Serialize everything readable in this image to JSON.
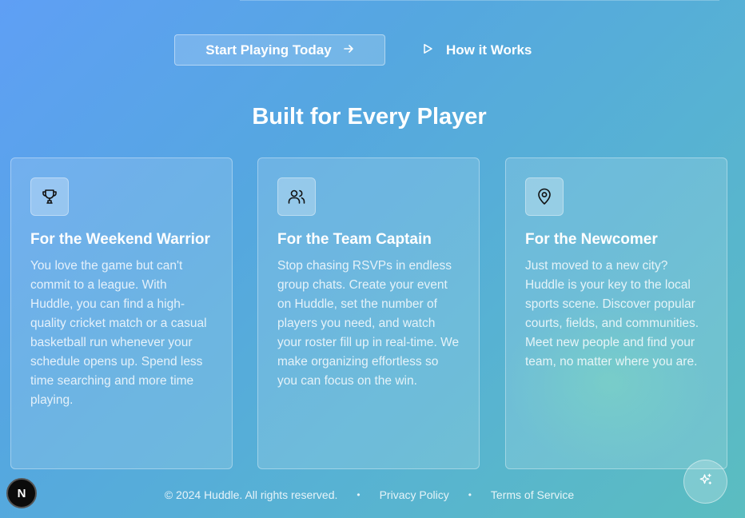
{
  "hero": {
    "primary_cta": "Start Playing Today",
    "primary_cta_icon": "arrow-right-icon",
    "secondary_cta": "How it Works",
    "secondary_cta_icon": "play-icon"
  },
  "section": {
    "title": "Built for Every Player",
    "cards": [
      {
        "icon": "trophy-icon",
        "title": "For the Weekend Warrior",
        "body": "You love the game but can't commit to a league. With Huddle, you can find a high-quality cricket match or a casual basketball run whenever your schedule opens up. Spend less time searching and more time playing."
      },
      {
        "icon": "users-icon",
        "title": "For the Team Captain",
        "body": "Stop chasing RSVPs in endless group chats. Create your event on Huddle, set the number of players you need, and watch your roster fill up in real-time. We make organizing effortless so you can focus on the win."
      },
      {
        "icon": "map-pin-icon",
        "title": "For the Newcomer",
        "body": "Just moved to a new city? Huddle is your key to the local sports scene. Discover popular courts, fields, and communities. Meet new people and find your team, no matter where you are."
      }
    ]
  },
  "footer": {
    "copyright": "© 2024 Huddle. All rights reserved.",
    "separator": "•",
    "privacy": "Privacy Policy",
    "terms": "Terms of Service"
  },
  "badge": {
    "letter": "N"
  },
  "colors": {
    "bg_start": "#5f9ff5",
    "bg_end": "#5bbdc0",
    "text": "#ffffff"
  }
}
